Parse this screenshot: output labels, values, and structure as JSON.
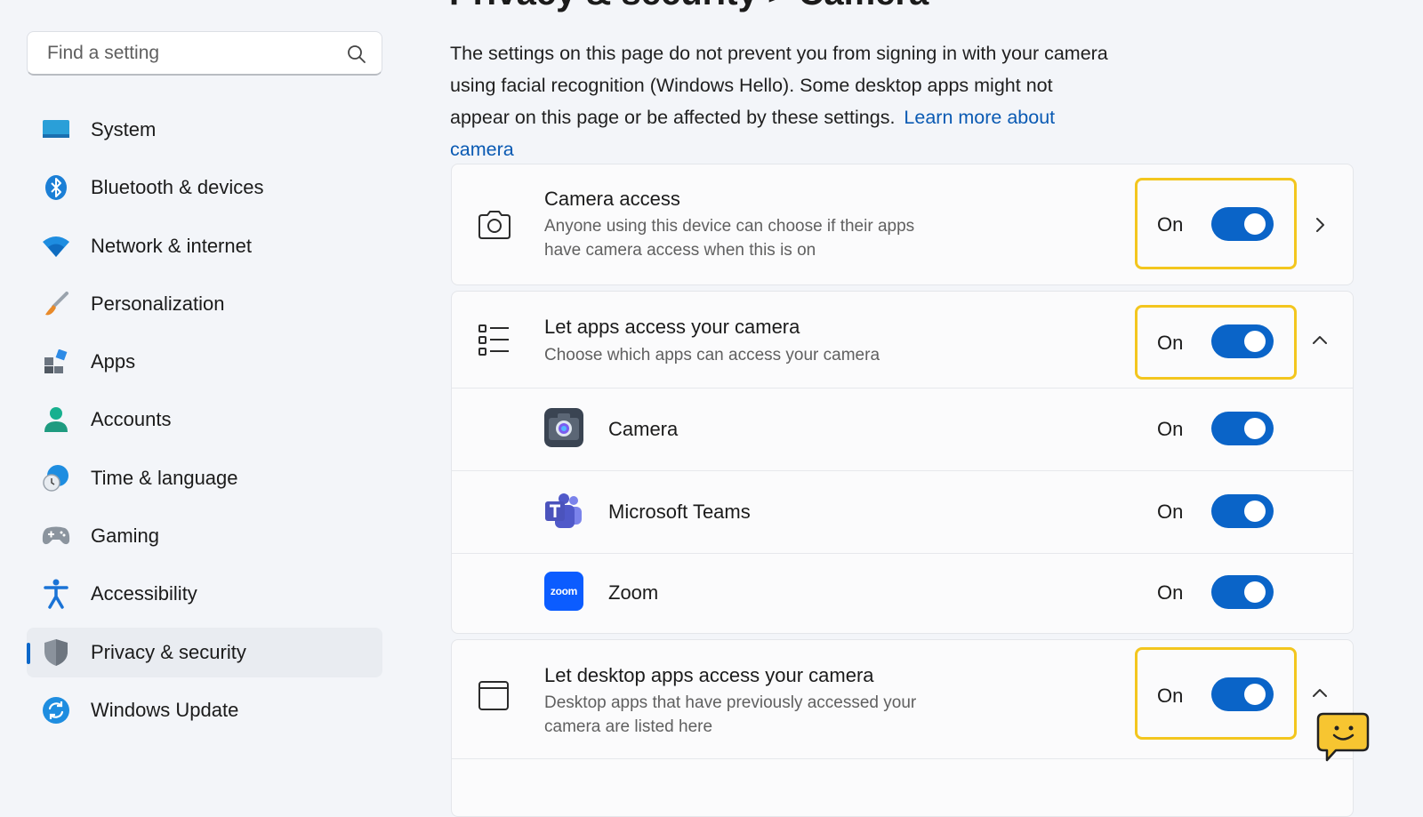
{
  "sidebar": {
    "search_placeholder": "Find a setting",
    "items": [
      {
        "label": "System",
        "icon": "monitor-icon"
      },
      {
        "label": "Bluetooth & devices",
        "icon": "bluetooth-icon"
      },
      {
        "label": "Network & internet",
        "icon": "wifi-icon"
      },
      {
        "label": "Personalization",
        "icon": "brush-icon"
      },
      {
        "label": "Apps",
        "icon": "apps-icon"
      },
      {
        "label": "Accounts",
        "icon": "person-icon"
      },
      {
        "label": "Time & language",
        "icon": "globe-clock-icon"
      },
      {
        "label": "Gaming",
        "icon": "gamepad-icon"
      },
      {
        "label": "Accessibility",
        "icon": "accessibility-icon"
      },
      {
        "label": "Privacy & security",
        "icon": "shield-icon",
        "selected": true
      },
      {
        "label": "Windows Update",
        "icon": "update-icon"
      }
    ]
  },
  "page": {
    "title": "Privacy & security  >  Camera",
    "intro_text": "The settings on this page do not prevent you from signing in with your camera using facial recognition (Windows Hello). Some desktop apps might not appear on this page or be affected by these settings.",
    "learn_more": "Learn more about camera"
  },
  "settings": {
    "camera_access": {
      "title": "Camera access",
      "description": "Anyone using this device can choose if their apps have camera access when this is on",
      "state": "On",
      "toggle_on": true,
      "icon": "camera-outline-icon"
    },
    "let_apps": {
      "title": "Let apps access your camera",
      "description": "Choose which apps can access your camera",
      "state": "On",
      "toggle_on": true,
      "icon": "list-icon"
    },
    "apps": [
      {
        "name": "Camera",
        "state": "On",
        "toggle_on": true,
        "icon": "camera-app-icon"
      },
      {
        "name": "Microsoft Teams",
        "state": "On",
        "toggle_on": true,
        "icon": "teams-icon"
      },
      {
        "name": "Zoom",
        "state": "On",
        "toggle_on": true,
        "icon": "zoom-icon",
        "icon_text": "zoom"
      }
    ],
    "desktop_apps": {
      "title": "Let desktop apps access your camera",
      "description": "Desktop apps that have previously accessed your camera are listed here",
      "state": "On",
      "toggle_on": true,
      "icon": "window-icon"
    }
  },
  "colors": {
    "accent": "#0a64c8",
    "highlight": "#f3c61e",
    "link": "#0a5ab3"
  }
}
